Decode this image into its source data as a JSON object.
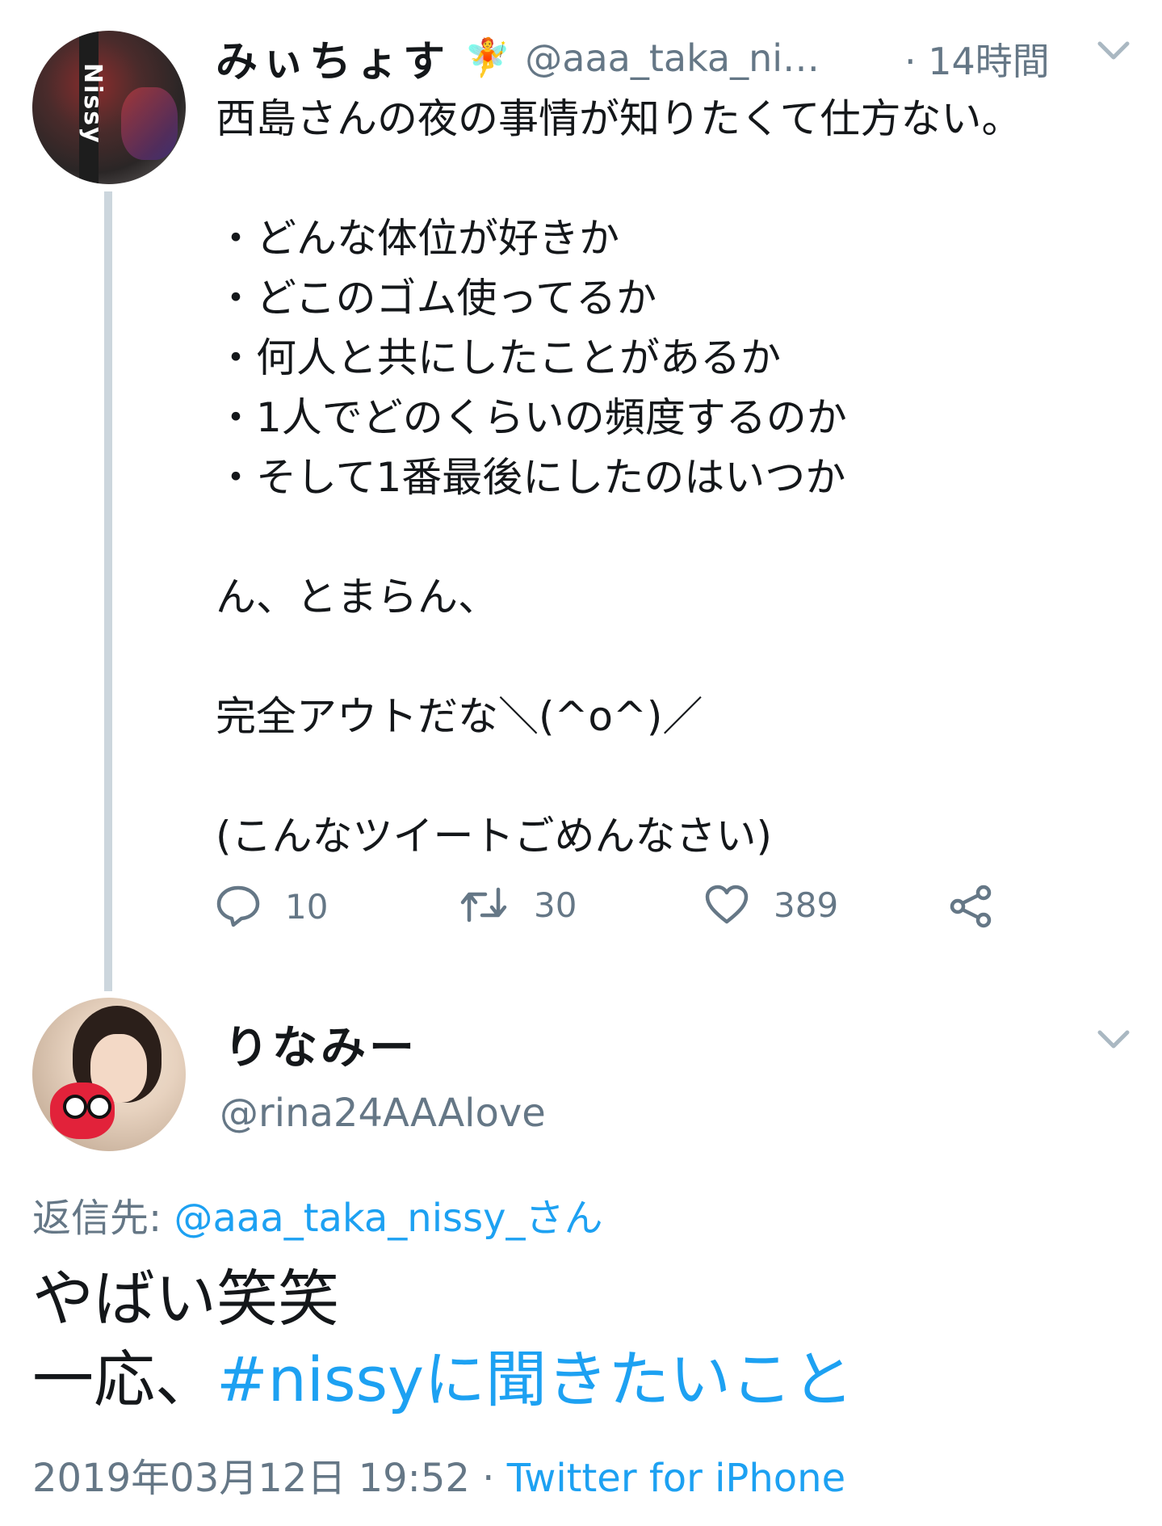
{
  "tweet1": {
    "name": "みぃちょす",
    "emoji": "🧚",
    "handle": "@aaa_taka_ni…",
    "separator": "·",
    "time": "14時間",
    "text": "西島さんの夜の事情が知りたくて仕方ない。\n\n・どんな体位が好きか\n・どこのゴム使ってるか\n・何人と共にしたことがあるか\n・1人でどのくらいの頻度するのか\n・そして1番最後にしたのはいつか\n\nん、とまらん、\n\n完全アウトだな＼(^o^)／\n\n(こんなツイートごめんなさい)",
    "avatar_text": "Nissy",
    "actions": {
      "reply_count": "10",
      "retweet_count": "30",
      "like_count": "389"
    }
  },
  "tweet2": {
    "name": "りなみー",
    "handle": "@rina24AAAlove",
    "reply_to_label": "返信先:",
    "reply_to_user": "@aaa_taka_nissy_さん",
    "text_line1": "やばい笑笑",
    "text_line2_prefix": "一応、",
    "hashtag": "#nissyに聞きたいこと",
    "timestamp": "2019年03月12日 19:52",
    "meta_separator": " · ",
    "source": "Twitter for iPhone"
  },
  "icons": {
    "reply": "reply-icon",
    "retweet": "retweet-icon",
    "like": "heart-icon",
    "share": "share-icon",
    "more": "chevron-down-icon"
  },
  "colors": {
    "link": "#1da1f2",
    "secondary": "#657786",
    "thread_line": "#ccd6dd"
  }
}
